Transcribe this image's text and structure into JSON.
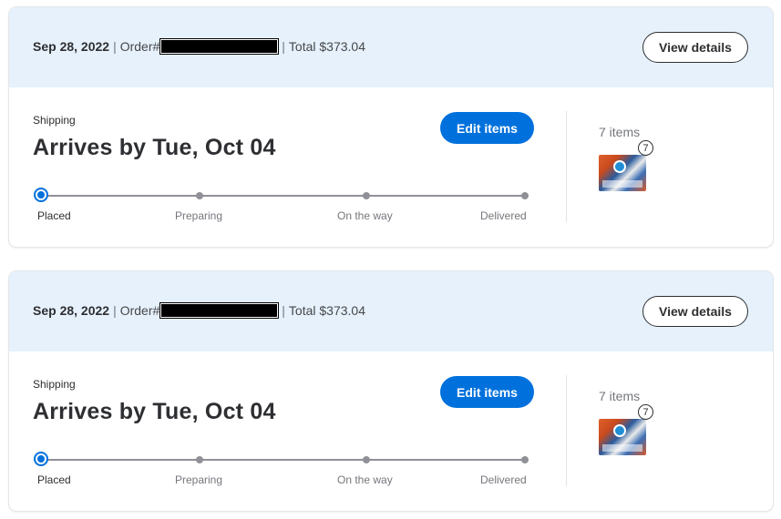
{
  "orders": [
    {
      "date": "Sep 28, 2022",
      "separator": "|",
      "order_label": "Order#",
      "total": "Total $373.04",
      "view_details_label": "View details",
      "shipping_label": "Shipping",
      "arrives": "Arrives by Tue, Oct 04",
      "edit_items_label": "Edit items",
      "steps": [
        "Placed",
        "Preparing",
        "On the way",
        "Delivered"
      ],
      "current_step": "Placed",
      "items_count": "7 items",
      "item_badge": "7",
      "thumbnail_icon": "trading-card-box-image"
    },
    {
      "date": "Sep 28, 2022",
      "separator": "|",
      "order_label": "Order#",
      "total": "Total $373.04",
      "view_details_label": "View details",
      "shipping_label": "Shipping",
      "arrives": "Arrives by Tue, Oct 04",
      "edit_items_label": "Edit items",
      "steps": [
        "Placed",
        "Preparing",
        "On the way",
        "Delivered"
      ],
      "current_step": "Placed",
      "items_count": "7 items",
      "item_badge": "7",
      "thumbnail_icon": "trading-card-box-image"
    }
  ],
  "colors": {
    "header_bg": "#e6f1fc",
    "primary_blue": "#0071dc",
    "text_dark": "#2e2f32",
    "text_muted": "#74767c"
  }
}
